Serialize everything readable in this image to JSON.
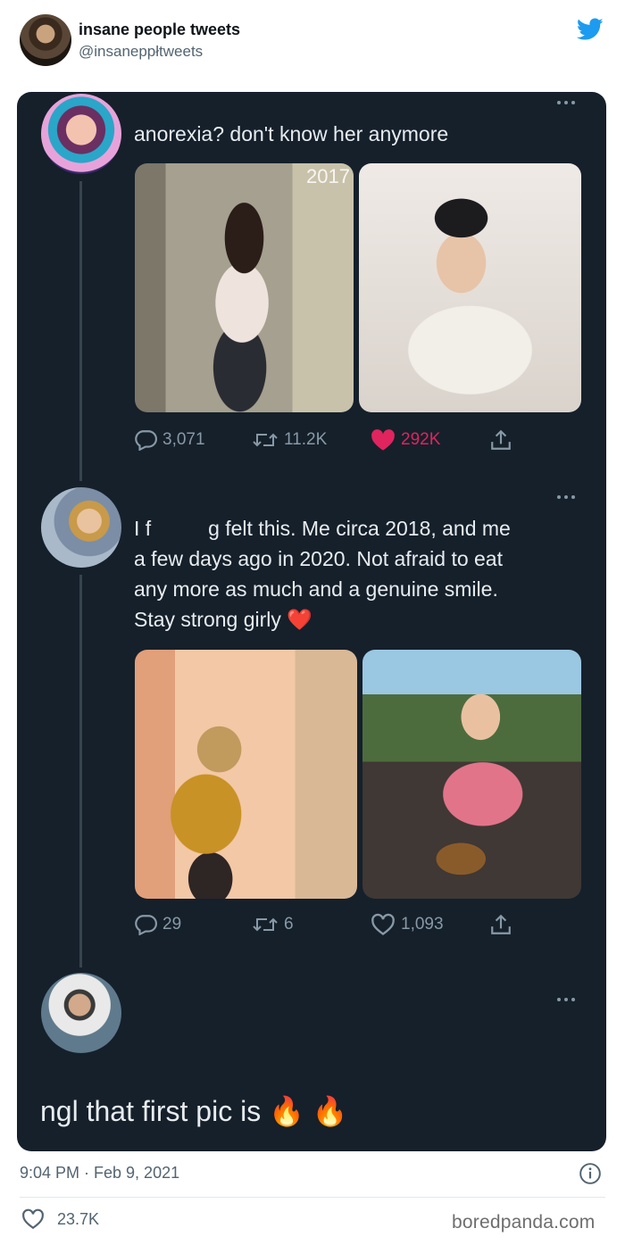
{
  "header": {
    "name": "insane people tweets",
    "handle": "@insaneppłtweets",
    "logo_icon": "twitter-bird-icon",
    "accent": "#1d9bf0"
  },
  "screenshot": {
    "background": "#15202b",
    "tweets": [
      {
        "text": "anorexia? don't know her anymore",
        "photo_year": "2017",
        "replies": "3,071",
        "retweets": "11.2K",
        "likes": "292K",
        "liked": true
      },
      {
        "text_lines": [
          "I f          g felt this. Me circa 2018, and me",
          "a few days ago in 2020. Not afraid to eat",
          "any more as much and a genuine smile.",
          "Stay strong girly ❤️"
        ],
        "replies": "29",
        "retweets": "6",
        "likes": "1,093",
        "liked": false
      },
      {
        "text": "ngl that first pic is 🔥 🔥"
      }
    ]
  },
  "footer": {
    "timestamp": "9:04 PM · Feb 9, 2021",
    "likes": "23.7K",
    "watermark": "boredpanda.com"
  }
}
